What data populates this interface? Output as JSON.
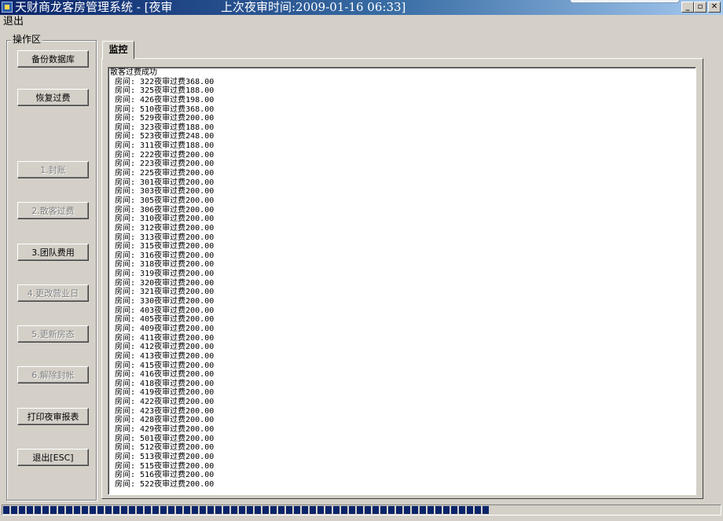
{
  "window": {
    "title": "天财商龙客房管理系统 - [夜审",
    "last_audit": "上次夜审时间:2009-01-16 06:33]",
    "controls": {
      "minimize": "_",
      "restore": "▫",
      "close": "✕"
    }
  },
  "menu": {
    "items": [
      {
        "label": "退出"
      }
    ]
  },
  "operations": {
    "legend": "操作区",
    "buttons": [
      {
        "label": "备份数据库",
        "enabled": true
      },
      {
        "label": "恢复过费",
        "enabled": true
      },
      {
        "label": "1.封账",
        "enabled": false
      },
      {
        "label": "2.散客过费",
        "enabled": false
      },
      {
        "label": "3.团队费用",
        "enabled": true
      },
      {
        "label": "4.更改营业日",
        "enabled": false
      },
      {
        "label": "5.更新房态",
        "enabled": false
      },
      {
        "label": "6.解除封帐",
        "enabled": false
      },
      {
        "label": "打印夜审报表",
        "enabled": true
      },
      {
        "label": "退出[ESC]",
        "enabled": true
      }
    ]
  },
  "tabs": [
    {
      "label": "监控",
      "active": true
    }
  ],
  "log": {
    "lines": [
      "散客过费成功",
      " 房间: 322夜审过费368.00",
      " 房间: 325夜审过费188.00",
      " 房间: 426夜审过费198.00",
      " 房间: 510夜审过费368.00",
      " 房间: 529夜审过费200.00",
      " 房间: 323夜审过费188.00",
      " 房间: 523夜审过费248.00",
      " 房间: 311夜审过费188.00",
      " 房间: 222夜审过费200.00",
      " 房间: 223夜审过费200.00",
      " 房间: 225夜审过费200.00",
      " 房间: 301夜审过费200.00",
      " 房间: 303夜审过费200.00",
      " 房间: 305夜审过费200.00",
      " 房间: 306夜审过费200.00",
      " 房间: 310夜审过费200.00",
      " 房间: 312夜审过费200.00",
      " 房间: 313夜审过费200.00",
      " 房间: 315夜审过费200.00",
      " 房间: 316夜审过费200.00",
      " 房间: 318夜审过费200.00",
      " 房间: 319夜审过费200.00",
      " 房间: 320夜审过费200.00",
      " 房间: 321夜审过费200.00",
      " 房间: 330夜审过费200.00",
      " 房间: 403夜审过费200.00",
      " 房间: 405夜审过费200.00",
      " 房间: 409夜审过费200.00",
      " 房间: 411夜审过费200.00",
      " 房间: 412夜审过费200.00",
      " 房间: 413夜审过费200.00",
      " 房间: 415夜审过费200.00",
      " 房间: 416夜审过费200.00",
      " 房间: 418夜审过费200.00",
      " 房间: 419夜审过费200.00",
      " 房间: 422夜审过费200.00",
      " 房间: 423夜审过费200.00",
      " 房间: 428夜审过费200.00",
      " 房间: 429夜审过费200.00",
      " 房间: 501夜审过费200.00",
      " 房间: 512夜审过费200.00",
      " 房间: 513夜审过费200.00",
      " 房间: 515夜审过费200.00",
      " 房间: 516夜审过费200.00",
      " 房间: 522夜审过费200.00"
    ]
  },
  "progress": {
    "fraction": 0.68,
    "color": "#0a246a"
  },
  "colors": {
    "titlebar_start": "#0a246a",
    "titlebar_end": "#a6caf0",
    "face": "#d4d0c8"
  }
}
